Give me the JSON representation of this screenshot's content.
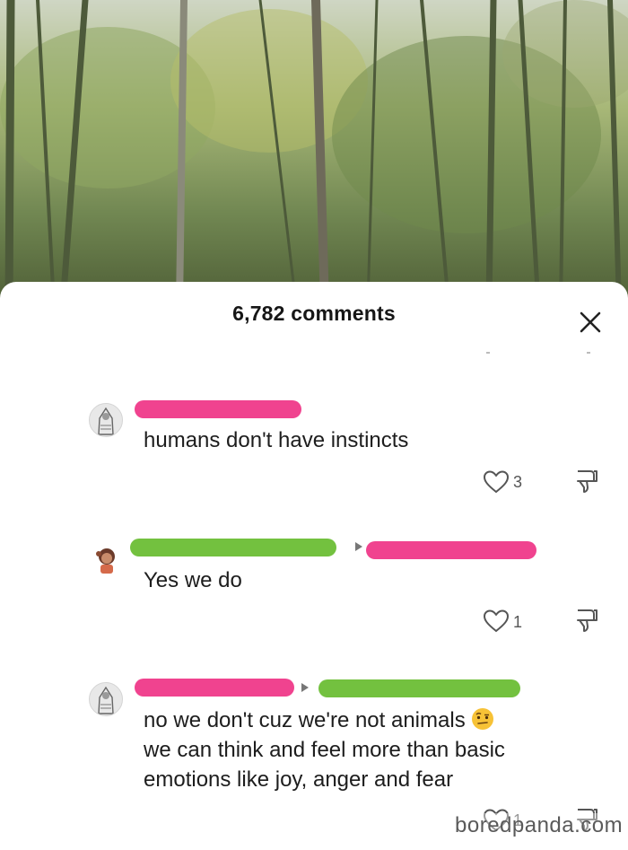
{
  "sheet": {
    "title": "6,782 comments",
    "close_icon": "close-icon"
  },
  "comments": [
    {
      "text": "humans don't have instincts",
      "likes": "3",
      "avatar": "hooded-figure-avatar",
      "redaction_color": "#f0438f"
    },
    {
      "text": "Yes we do",
      "likes": "1",
      "avatar": "cartoon-character-avatar",
      "redaction_color": "#73c13f",
      "reply_to_color": "#f0438f"
    },
    {
      "text_line1": "no we don't cuz we're not animals",
      "emoji": "raised-eyebrow-emoji",
      "text_line2": "we can think and feel more than basic",
      "text_line3": "emotions like joy, anger and fear",
      "likes": "1",
      "avatar": "hooded-figure-avatar",
      "redaction_color": "#f0438f",
      "reply_to_color": "#73c13f"
    }
  ],
  "watermark": "boredpanda.com",
  "colors": {
    "pink_redaction": "#f0438f",
    "green_redaction": "#73c13f"
  }
}
